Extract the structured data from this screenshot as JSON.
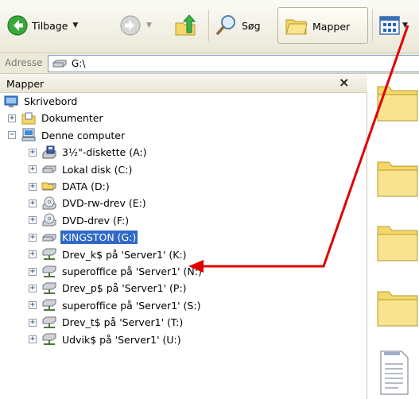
{
  "toolbar": {
    "back_label": "Tilbage",
    "search_label": "Søg",
    "folders_label": "Mapper"
  },
  "address": {
    "label": "Adresse",
    "value": "G:\\"
  },
  "folder_pane": {
    "title": "Mapper",
    "close_symbol": "×"
  },
  "tree": [
    {
      "label": "Skrivebord",
      "icon": "desktop-icon",
      "expander": ""
    },
    {
      "label": "Dokumenter",
      "icon": "documents-folder-icon",
      "expander": "+"
    },
    {
      "label": "Denne computer",
      "icon": "my-computer-icon",
      "expander": "−"
    },
    {
      "label": "3½\"-diskette (A:)",
      "icon": "floppy-drive-icon",
      "expander": "+"
    },
    {
      "label": "Lokal disk (C:)",
      "icon": "hard-disk-icon",
      "expander": "+"
    },
    {
      "label": "DATA (D:)",
      "icon": "data-drive-icon",
      "expander": "+"
    },
    {
      "label": "DVD-rw-drev (E:)",
      "icon": "dvd-rw-drive-icon",
      "expander": "+"
    },
    {
      "label": "DVD-drev (F:)",
      "icon": "dvd-drive-icon",
      "expander": "+"
    },
    {
      "label": "KINGSTON (G:)",
      "icon": "removable-drive-icon",
      "expander": "+",
      "selected": true
    },
    {
      "label": "Drev_k$ på 'Server1' (K:)",
      "icon": "network-drive-icon",
      "expander": "+"
    },
    {
      "label": "superoffice på 'Server1' (N:)",
      "icon": "network-drive-icon",
      "expander": "+"
    },
    {
      "label": "Drev_p$ på 'Server1' (P:)",
      "icon": "network-drive-icon",
      "expander": "+"
    },
    {
      "label": "superoffice på 'Server1' (S:)",
      "icon": "network-drive-icon",
      "expander": "+"
    },
    {
      "label": "Drev_t$ på 'Server1' (T:)",
      "icon": "network-drive-icon",
      "expander": "+"
    },
    {
      "label": "Udvik$ på 'Server1' (U:)",
      "icon": "network-drive-icon",
      "expander": "+"
    }
  ],
  "colors": {
    "selection": "#316ac5",
    "annotation_arrow": "#e00000",
    "folder_yellow": "#f3d768"
  }
}
